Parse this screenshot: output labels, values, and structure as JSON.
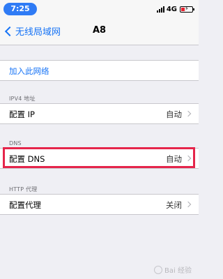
{
  "status_bar": {
    "time": "7:25",
    "network": "4G"
  },
  "nav": {
    "back_label": "无线局域网",
    "title": "A8"
  },
  "join": {
    "label": "加入此网络"
  },
  "ipv4": {
    "header": "IPV4 地址",
    "configure_ip_label": "配置 IP",
    "configure_ip_value": "自动"
  },
  "dns": {
    "header": "DNS",
    "configure_dns_label": "配置 DNS",
    "configure_dns_value": "自动"
  },
  "proxy": {
    "header": "HTTP 代理",
    "configure_proxy_label": "配置代理",
    "configure_proxy_value": "关闭"
  },
  "colors": {
    "accent": "#1673f6",
    "highlight": "#e5254b",
    "background": "#efeff4"
  },
  "watermark": {
    "text": "Bai 经验"
  }
}
